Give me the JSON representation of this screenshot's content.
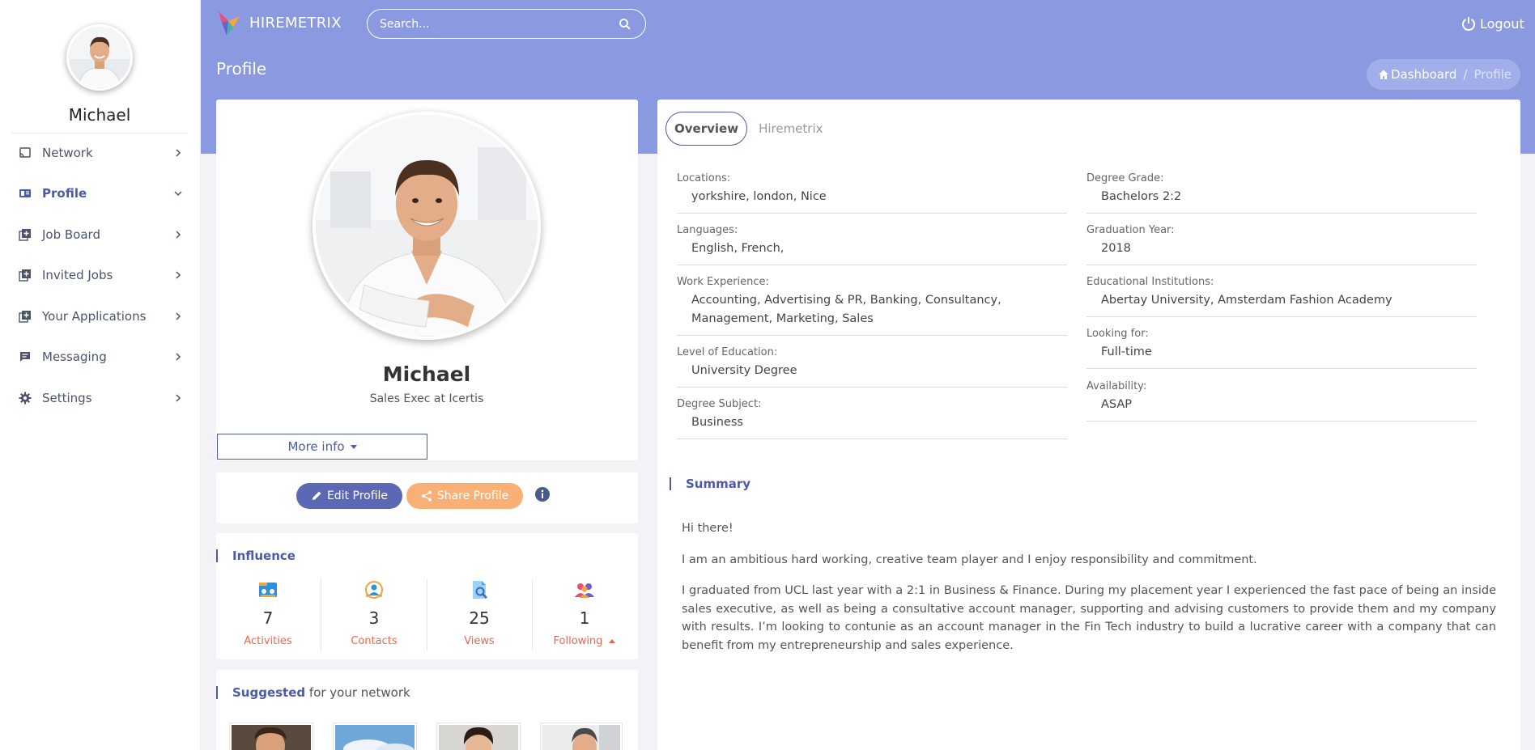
{
  "sidebar": {
    "user_name": "Michael",
    "items": [
      {
        "label": "Network",
        "icon": "cast-icon"
      },
      {
        "label": "Profile",
        "icon": "id-card-icon",
        "active": true
      },
      {
        "label": "Job Board",
        "icon": "library-add-icon"
      },
      {
        "label": "Invited Jobs",
        "icon": "library-add-icon"
      },
      {
        "label": "Your Applications",
        "icon": "library-add-icon"
      },
      {
        "label": "Messaging",
        "icon": "chat-icon"
      },
      {
        "label": "Settings",
        "icon": "gear-icon"
      }
    ]
  },
  "header": {
    "brand": "HIREMETRIX",
    "search_placeholder": "Search...",
    "logout_label": "Logout"
  },
  "page": {
    "title": "Profile",
    "breadcrumb": {
      "home": "Dashboard",
      "separator": "/",
      "current": "Profile"
    }
  },
  "profile": {
    "name": "Michael",
    "headline": "Sales Exec at Icertis",
    "more_info_label": "More info",
    "edit_label": "Edit Profile",
    "share_label": "Share Profile"
  },
  "influence": {
    "title": "Influence",
    "stats": [
      {
        "value": "7",
        "label": "Activities"
      },
      {
        "value": "3",
        "label": "Contacts"
      },
      {
        "value": "25",
        "label": "Views"
      },
      {
        "value": "1",
        "label": "Following"
      }
    ]
  },
  "suggested": {
    "title_bold": "Suggested",
    "title_rest": " for your network"
  },
  "tabs": [
    {
      "label": "Overview",
      "active": true
    },
    {
      "label": "Hiremetrix",
      "active": false
    }
  ],
  "overview": {
    "left": [
      {
        "label": "Locations:",
        "value": "yorkshire, london, Nice"
      },
      {
        "label": "Languages:",
        "value": "English, French,"
      },
      {
        "label": "Work Experience:",
        "value": "Accounting, Advertising & PR, Banking, Consultancy, Management, Marketing, Sales"
      },
      {
        "label": "Level of Education:",
        "value": "University Degree"
      },
      {
        "label": "Degree Subject:",
        "value": "Business"
      }
    ],
    "right": [
      {
        "label": "Degree Grade:",
        "value": "Bachelors 2:2"
      },
      {
        "label": "Graduation Year:",
        "value": "2018"
      },
      {
        "label": "Educational Institutions:",
        "value": "Abertay University, Amsterdam Fashion Academy"
      },
      {
        "label": "Looking for:",
        "value": "Full-time"
      },
      {
        "label": "Availability:",
        "value": "ASAP"
      }
    ]
  },
  "summary": {
    "title": "Summary",
    "paragraphs": [
      "Hi there!",
      "I am an ambitious hard working, creative team player and I enjoy responsibility and commitment.",
      "I graduated from UCL last year with a 2:1 in Business & Finance. During my placement year I experienced the fast pace of being an inside sales executive, as well as being a consultative account manager, supporting and advising customers to provide them and my company with results. I’m looking to contunie as an account manager in the Fin Tech industry to build a lucrative career with a company that can benefit from my entrepreneurship and sales experience."
    ]
  },
  "colors": {
    "header": "#8a99e0",
    "accent": "#4d5aa8",
    "edit_button": "#5d68b4",
    "share_button": "#f9b077",
    "stat_label": "#e8674c"
  }
}
